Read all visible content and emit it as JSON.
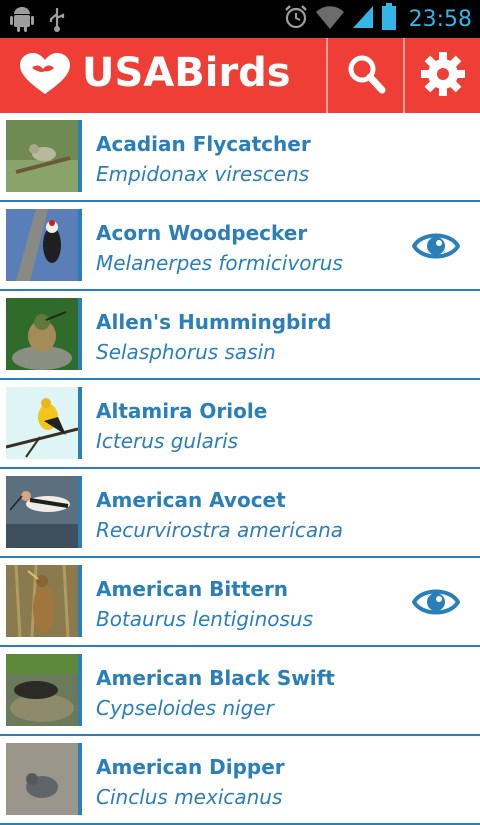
{
  "status_bar": {
    "time": "23:58",
    "icons": [
      "android-debug-icon",
      "usb-icon",
      "alarm-icon",
      "wifi-icon",
      "signal-icon",
      "battery-icon"
    ]
  },
  "action_bar": {
    "title": "USABirds",
    "logo_icon": "heart-bird-logo-icon",
    "search_icon": "search-icon",
    "settings_icon": "gear-icon",
    "background": "#ef3e36"
  },
  "birds": [
    {
      "name": "Acadian Flycatcher",
      "scientific": "Empidonax virescens",
      "seen": false
    },
    {
      "name": "Acorn Woodpecker",
      "scientific": "Melanerpes formicivorus",
      "seen": true
    },
    {
      "name": "Allen's Hummingbird",
      "scientific": "Selasphorus sasin",
      "seen": false
    },
    {
      "name": "Altamira Oriole",
      "scientific": "Icterus gularis",
      "seen": false
    },
    {
      "name": "American Avocet",
      "scientific": "Recurvirostra americana",
      "seen": false
    },
    {
      "name": "American Bittern",
      "scientific": "Botaurus lentiginosus",
      "seen": true
    },
    {
      "name": "American Black Swift",
      "scientific": "Cypseloides niger",
      "seen": false
    },
    {
      "name": "American Dipper",
      "scientific": "Cinclus mexicanus",
      "seen": false
    }
  ],
  "colors": {
    "accent": "#2b7fb8",
    "brand": "#ef3e36",
    "status_icon": "#33b5e5"
  }
}
